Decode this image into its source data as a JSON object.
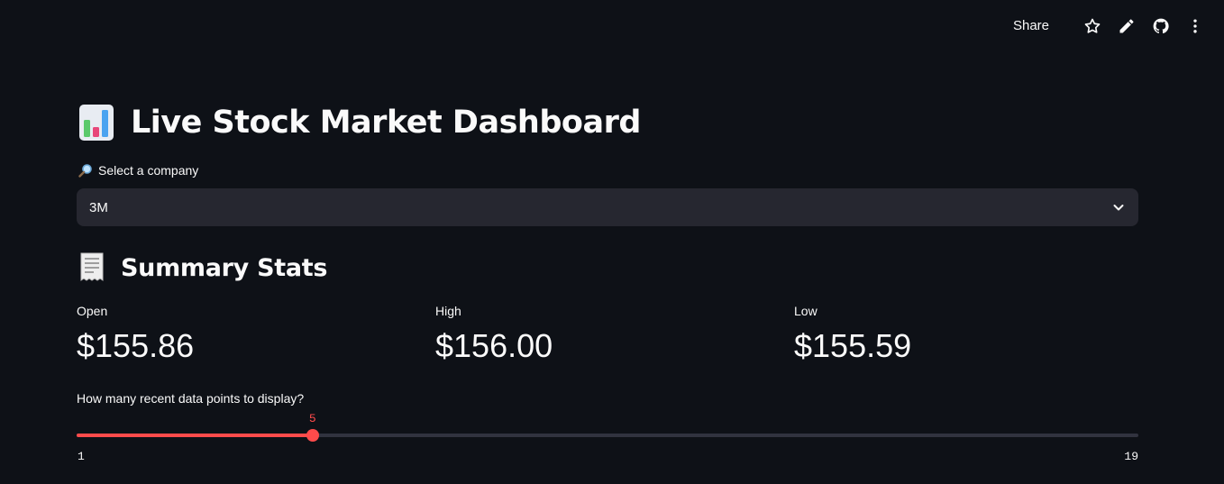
{
  "toolbar": {
    "share_label": "Share",
    "icons": [
      "star-icon",
      "pencil-icon",
      "github-icon",
      "kebab-menu-icon"
    ]
  },
  "header": {
    "title": "Live Stock Market Dashboard",
    "title_icon": "bar-chart-icon"
  },
  "company_select": {
    "label": "Select a company",
    "label_icon": "magnifying-glass-icon",
    "value": "3M"
  },
  "summary": {
    "title": "Summary Stats",
    "title_icon": "receipt-icon",
    "metrics": [
      {
        "label": "Open",
        "value": "$155.86"
      },
      {
        "label": "High",
        "value": "$156.00"
      },
      {
        "label": "Low",
        "value": "$155.59"
      }
    ]
  },
  "points_slider": {
    "label": "How many recent data points to display?",
    "value": 5,
    "value_label": "5",
    "min": 1,
    "min_label": "1",
    "max": 19,
    "max_label": "19"
  },
  "colors": {
    "background": "#0e1117",
    "accent": "#ff4b4b",
    "input_bg": "#262730",
    "text": "#fafafa"
  }
}
